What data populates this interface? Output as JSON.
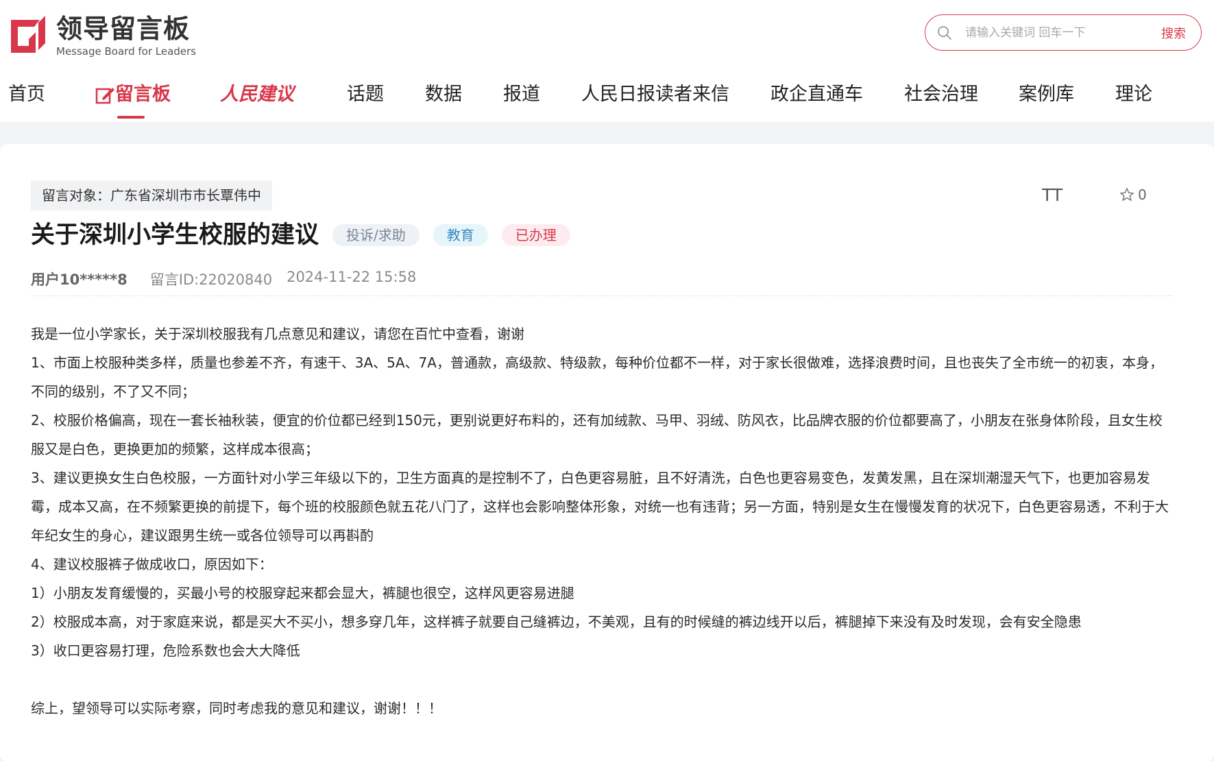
{
  "header": {
    "logo_cn": "领导留言板",
    "logo_en": "Message Board for Leaders",
    "search_placeholder": "请输入关键词 回车一下",
    "search_button": "搜索"
  },
  "nav": {
    "home": "首页",
    "message_board": "留言板",
    "people_suggest": "人民建议",
    "topics": "话题",
    "data": "数据",
    "reports": "报道",
    "letters": "人民日报读者来信",
    "gov_enterprise": "政企直通车",
    "social_governance": "社会治理",
    "case_library": "案例库",
    "theory": "理论"
  },
  "message": {
    "target": "留言对象：广东省深圳市市长覃伟中",
    "font_toggle": "TT",
    "favorite_count": "0",
    "title": "关于深圳小学生校服的建议",
    "tags": [
      "投诉/求助",
      "教育",
      "已办理"
    ],
    "user": "用户10*****8",
    "message_id": "留言ID:22020840",
    "date": "2024-11-22 15:58",
    "paragraphs": [
      "我是一位小学家长，关于深圳校服我有几点意见和建议，请您在百忙中查看，谢谢",
      "1、市面上校服种类多样，质量也参差不齐，有速干、3A、5A、7A，普通款，高级款、特级款，每种价位都不一样，对于家长很做难，选择浪费时间，且也丧失了全市统一的初衷，本身，不同的级别，不了又不同；",
      "2、校服价格偏高，现在一套长袖秋装，便宜的价位都已经到150元，更别说更好布料的，还有加绒款、马甲、羽绒、防风衣，比品牌衣服的价位都要高了，小朋友在张身体阶段，且女生校服又是白色，更换更加的频繁，这样成本很高；",
      "3、建议更换女生白色校服，一方面针对小学三年级以下的，卫生方面真的是控制不了，白色更容易脏，且不好清洗，白色也更容易变色，发黄发黑，且在深圳潮湿天气下，也更加容易发霉，成本又高，在不频繁更换的前提下，每个班的校服颜色就五花八门了，这样也会影响整体形象，对统一也有违背；另一方面，特别是女生在慢慢发育的状况下，白色更容易透，不利于大年纪女生的身心，建议跟男生统一或各位领导可以再斟酌",
      "4、建议校服裤子做成收口，原因如下：",
      "1）小朋友发育缓慢的，买最小号的校服穿起来都会显大，裤腿也很空，这样风更容易进腿",
      "2）校服成本高，对于家庭来说，都是买大不买小，想多穿几年，这样裤子就要自己缝裤边，不美观，且有的时候缝的裤边线开以后，裤腿掉下来没有及时发现，会有安全隐患",
      "3）收口更容易打理，危险系数也会大大降低",
      "",
      "综上，望领导可以实际考察，同时考虑我的意见和建议，谢谢！！！"
    ]
  },
  "colors": {
    "brand_red": "#d9374b",
    "page_bg": "#f3f4f6"
  },
  "icons": [
    "logo-mark-icon",
    "search-icon",
    "edit-icon",
    "star-icon"
  ]
}
